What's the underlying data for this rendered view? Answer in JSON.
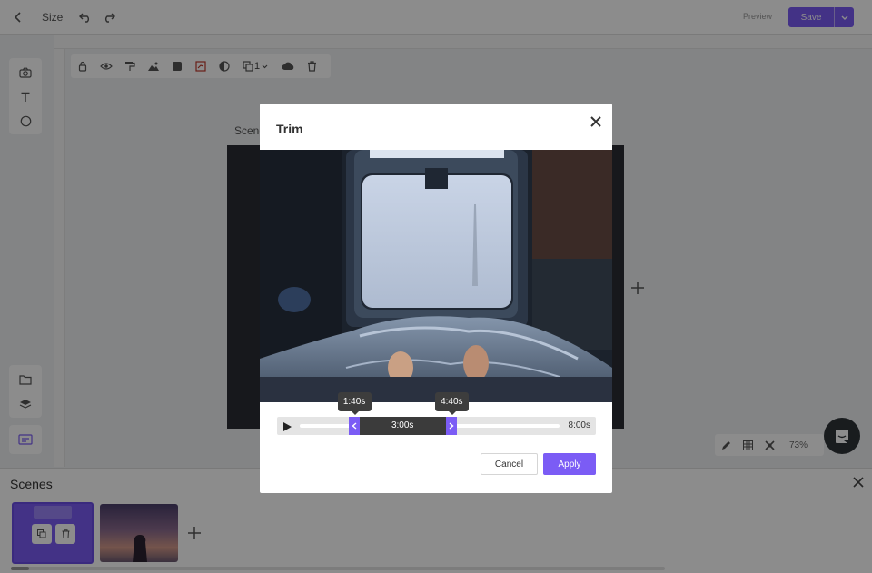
{
  "topbar": {
    "size_label": "Size",
    "preview_label": "Preview",
    "save_label": "Save"
  },
  "editor": {
    "canvas_label": "Scene",
    "zoom_value": "73%",
    "element_count": "1"
  },
  "scenes": {
    "title": "Scenes"
  },
  "trim_modal": {
    "title": "Trim",
    "start_time": "1:40s",
    "end_time": "4:40s",
    "selection_duration": "3:00s",
    "total_duration": "8:00s",
    "start_fraction": 0.2083,
    "end_fraction": 0.5833,
    "cancel_label": "Cancel",
    "apply_label": "Apply"
  },
  "colors": {
    "accent": "#7b5cf5",
    "overlay": "rgba(0,0,0,0.45)",
    "tooltip": "#3d3d3d"
  },
  "icons": {
    "back": "chevron-left-icon",
    "undo": "undo-icon",
    "redo": "redo-icon",
    "close": "close-icon",
    "play": "play-icon",
    "camera": "camera-icon",
    "text": "text-icon",
    "shape": "circle-icon",
    "folder": "folder-icon",
    "layers": "layers-icon",
    "chat": "chat-icon"
  }
}
